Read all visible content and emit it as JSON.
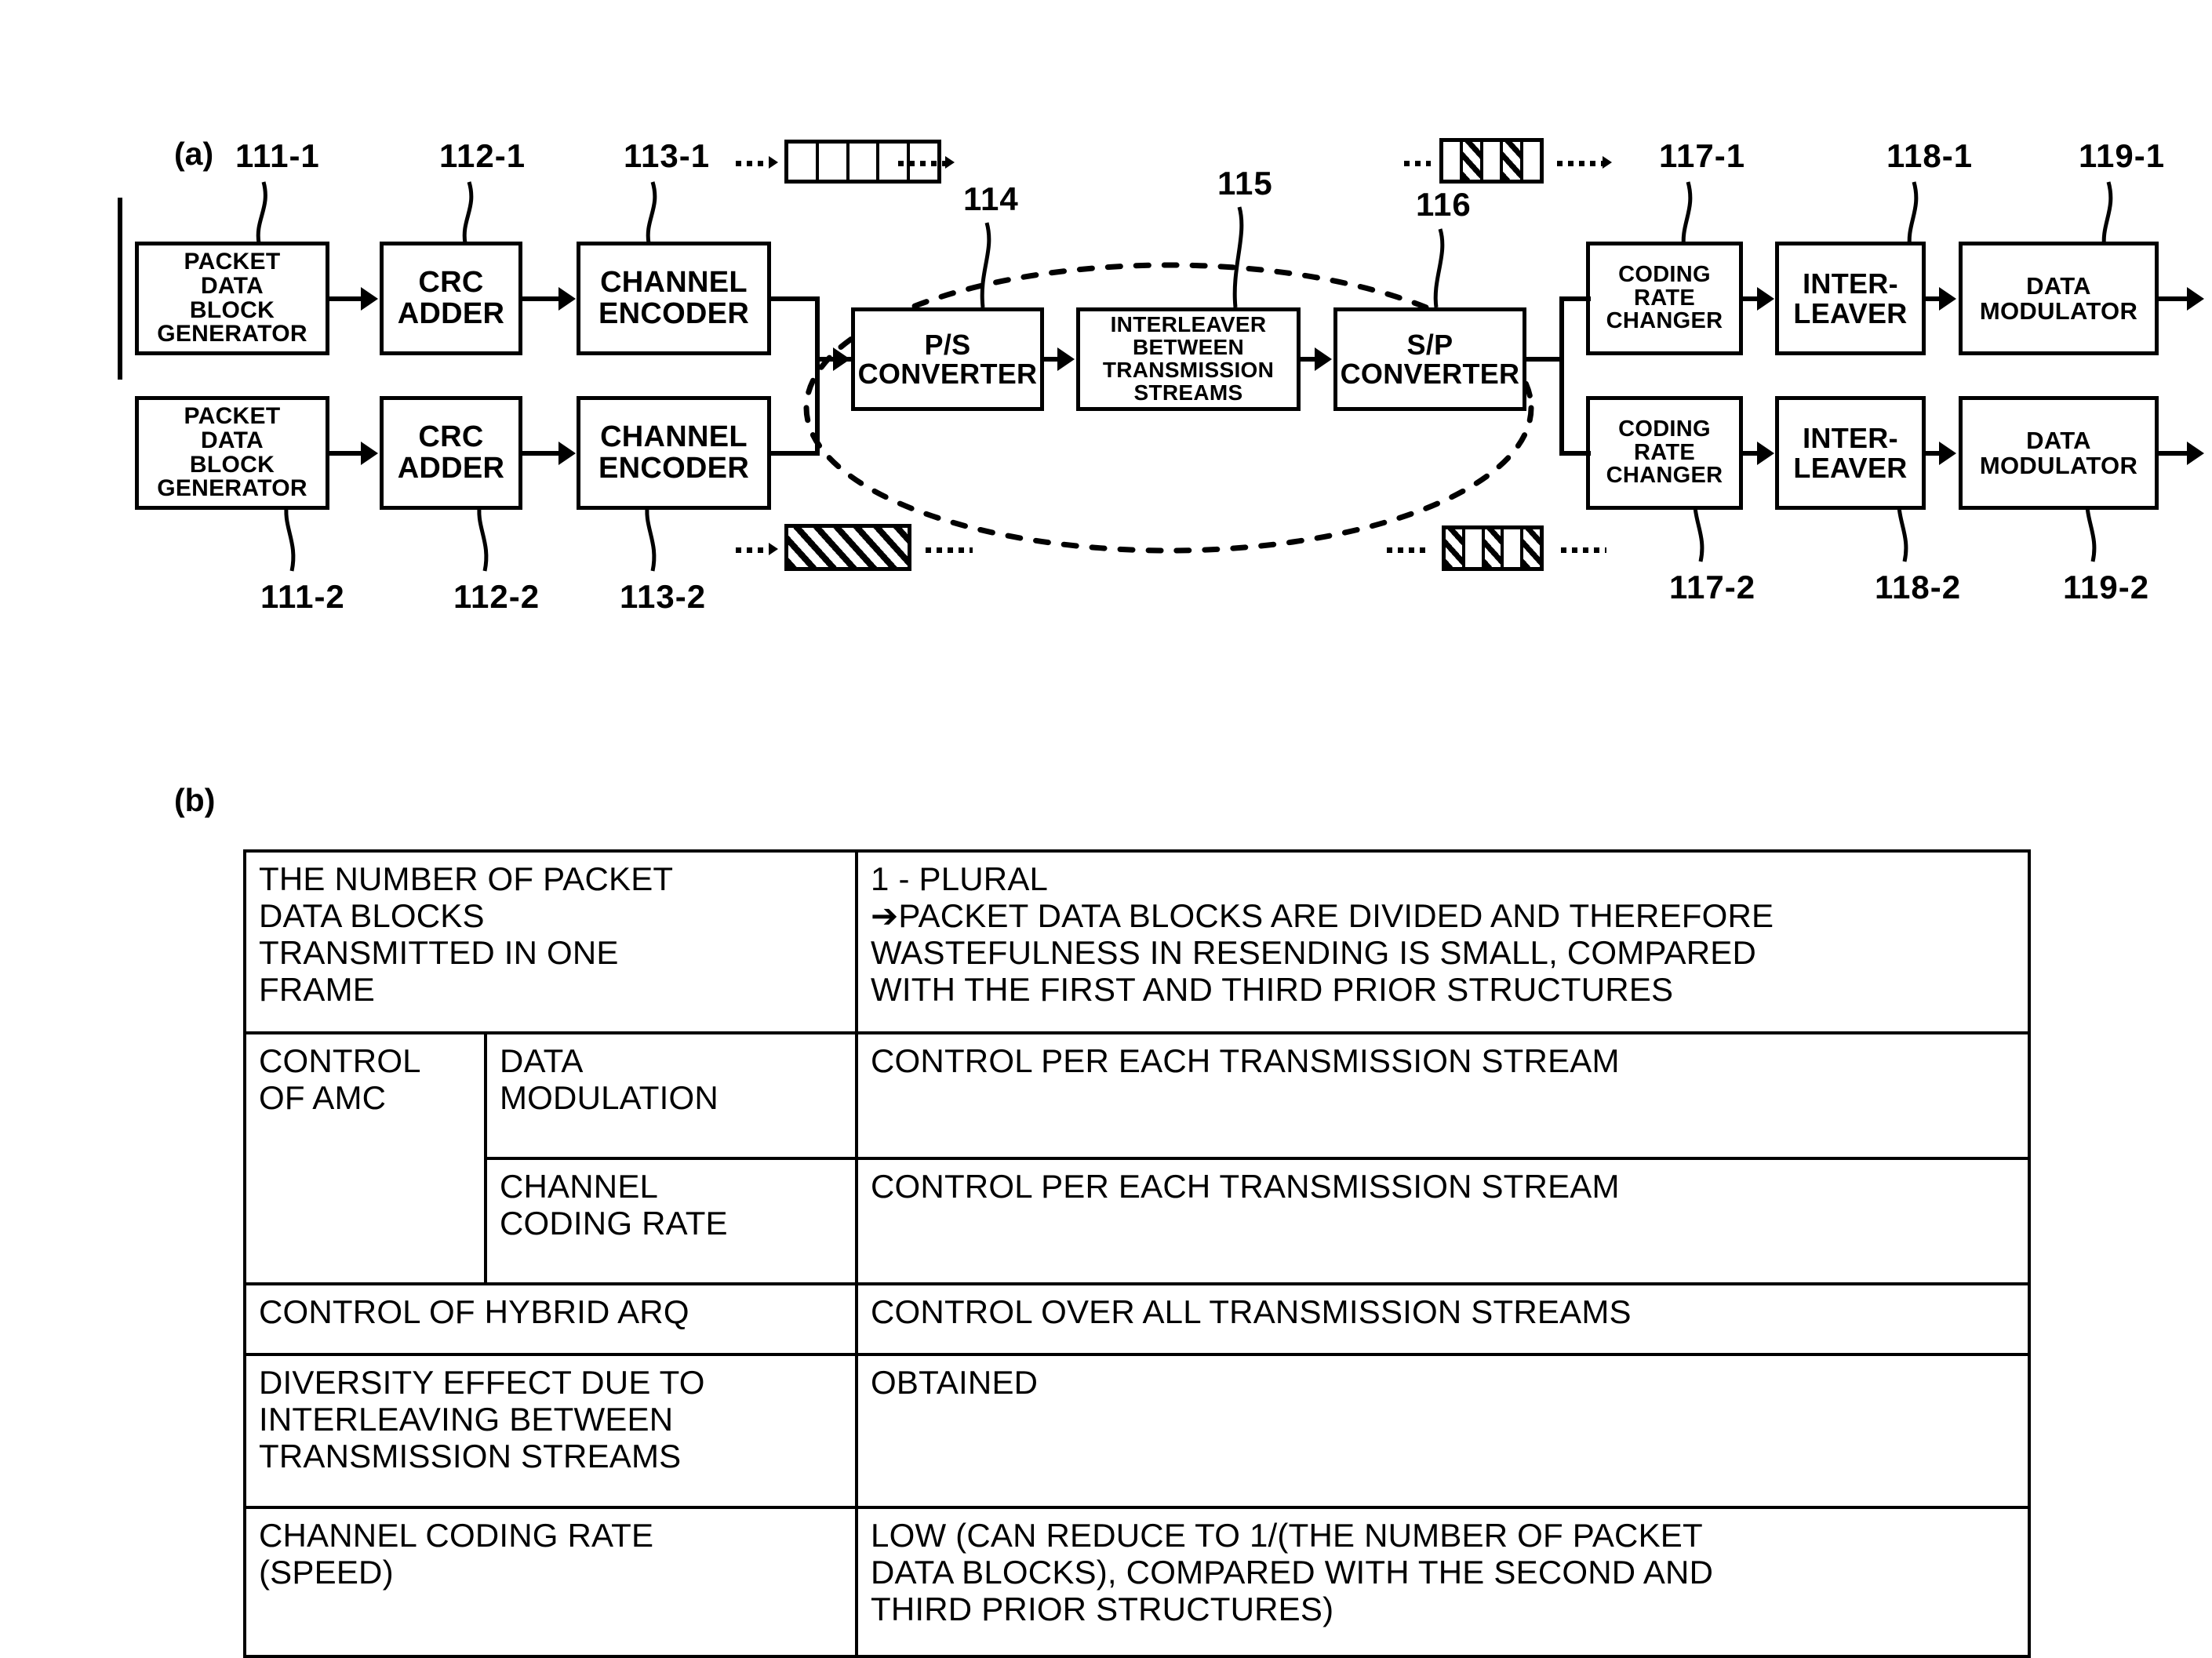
{
  "figure_a": {
    "label": "(a)",
    "blocks": [
      {
        "id": "pdbg1",
        "text": "PACKET\nDATA\nBLOCK\nGENERATOR",
        "ref": "111-1"
      },
      {
        "id": "crc1",
        "text": "CRC\nADDER",
        "ref": "112-1"
      },
      {
        "id": "chenc1",
        "text": "CHANNEL\nENCODER",
        "ref": "113-1"
      },
      {
        "id": "pdbg2",
        "text": "PACKET\nDATA\nBLOCK\nGENERATOR",
        "ref": "111-2"
      },
      {
        "id": "crc2",
        "text": "CRC\nADDER",
        "ref": "112-2"
      },
      {
        "id": "chenc2",
        "text": "CHANNEL\nENCODER",
        "ref": "113-2"
      },
      {
        "id": "ps",
        "text": "P/S\nCONVERTER",
        "ref": "114"
      },
      {
        "id": "intl",
        "text": "INTERLEAVER\nBETWEEN\nTRANSMISSION\nSTREAMS",
        "ref": "115"
      },
      {
        "id": "sp",
        "text": "S/P\nCONVERTER",
        "ref": "116"
      },
      {
        "id": "crc_rate1",
        "text": "CODING\nRATE\nCHANGER",
        "ref": "117-1"
      },
      {
        "id": "inter1",
        "text": "INTER-\nLEAVER",
        "ref": "118-1"
      },
      {
        "id": "dmod1",
        "text": "DATA\nMODULATOR",
        "ref": "119-1"
      },
      {
        "id": "crc_rate2",
        "text": "CODING\nRATE\nCHANGER",
        "ref": "117-2"
      },
      {
        "id": "inter2",
        "text": "INTER-\nLEAVER",
        "ref": "118-2"
      },
      {
        "id": "dmod2",
        "text": "DATA\nMODULATOR",
        "ref": "119-2"
      }
    ],
    "block_text": {
      "pdbg1_l1": "PACKET",
      "pdbg1_l2": "DATA",
      "pdbg1_l3": "BLOCK",
      "pdbg1_l4": "GENERATOR",
      "crc1_l1": "CRC",
      "crc1_l2": "ADDER",
      "chenc1_l1": "CHANNEL",
      "chenc1_l2": "ENCODER",
      "pdbg2_l1": "PACKET",
      "pdbg2_l2": "DATA",
      "pdbg2_l3": "BLOCK",
      "pdbg2_l4": "GENERATOR",
      "crc2_l1": "CRC",
      "crc2_l2": "ADDER",
      "chenc2_l1": "CHANNEL",
      "chenc2_l2": "ENCODER",
      "ps_l1": "P/S",
      "ps_l2": "CONVERTER",
      "intl_l1": "INTERLEAVER",
      "intl_l2": "BETWEEN",
      "intl_l3": "TRANSMISSION",
      "intl_l4": "STREAMS",
      "sp_l1": "S/P",
      "sp_l2": "CONVERTER",
      "crate1_l1": "CODING",
      "crate1_l2": "RATE",
      "crate1_l3": "CHANGER",
      "inter1_l1": "INTER-",
      "inter1_l2": "LEAVER",
      "dmod1_l1": "DATA",
      "dmod1_l2": "MODULATOR",
      "crate2_l1": "CODING",
      "crate2_l2": "RATE",
      "crate2_l3": "CHANGER",
      "inter2_l1": "INTER-",
      "inter2_l2": "LEAVER",
      "dmod2_l1": "DATA",
      "dmod2_l2": "MODULATOR"
    },
    "refs": {
      "r111_1": "111-1",
      "r112_1": "112-1",
      "r113_1": "113-1",
      "r111_2": "111-2",
      "r112_2": "112-2",
      "r113_2": "113-2",
      "r114": "114",
      "r115": "115",
      "r116": "116",
      "r117_1": "117-1",
      "r118_1": "118-1",
      "r119_1": "119-1",
      "r117_2": "117-2",
      "r118_2": "118-2",
      "r119_2": "119-2"
    },
    "frame_glyphs": [
      {
        "id": "g113_1",
        "cells": [
          "w",
          "w",
          "w",
          "w",
          "w"
        ]
      },
      {
        "id": "g113_2",
        "cells": [
          "h"
        ]
      },
      {
        "id": "g116",
        "cells": [
          "w",
          "h",
          "w",
          "h",
          "w"
        ]
      },
      {
        "id": "g117_2",
        "cells": [
          "h",
          "w",
          "h",
          "w",
          "h"
        ]
      }
    ]
  },
  "figure_b": {
    "label": "(b)",
    "rows": [
      {
        "label": "THE NUMBER OF PACKET DATA BLOCKS TRANSMITTED IN ONE FRAME",
        "value": "1 - PLURAL\n➔PACKET DATA BLOCKS ARE DIVIDED AND THEREFORE WASTEFULNESS IN RESENDING IS SMALL, COMPARED WITH THE FIRST AND THIRD PRIOR STRUCTURES"
      },
      {
        "label": "CONTROL OF AMC",
        "sublabel": "DATA MODULATION",
        "value": "CONTROL PER EACH TRANSMISSION STREAM"
      },
      {
        "sublabel": "CHANNEL CODING RATE",
        "value": "CONTROL PER EACH TRANSMISSION STREAM"
      },
      {
        "label": "CONTROL OF HYBRID ARQ",
        "value": "CONTROL OVER ALL TRANSMISSION STREAMS"
      },
      {
        "label": "DIVERSITY EFFECT DUE TO INTERLEAVING BETWEEN TRANSMISSION STREAMS",
        "value": "OBTAINED"
      },
      {
        "label": "CHANNEL CODING RATE (SPEED)",
        "value": "LOW (CAN REDUCE TO 1/(THE NUMBER OF PACKET DATA BLOCKS), COMPARED WITH THE SECOND AND THIRD PRIOR STRUCTURES)"
      }
    ],
    "cells": {
      "r1_label_l1": "THE NUMBER OF PACKET",
      "r1_label_l2": "DATA BLOCKS",
      "r1_label_l3": "TRANSMITTED IN ONE",
      "r1_label_l4": "FRAME",
      "r1_val_l1": "1 - PLURAL",
      "r1_val_l2": "➔PACKET DATA BLOCKS ARE DIVIDED AND THEREFORE",
      "r1_val_l3": "WASTEFULNESS IN RESENDING IS SMALL, COMPARED",
      "r1_val_l4": "WITH THE FIRST AND THIRD PRIOR STRUCTURES",
      "r2_label_l1": "CONTROL",
      "r2_label_l2": "OF AMC",
      "r2_sub_l1": "DATA",
      "r2_sub_l2": "MODULATION",
      "r2_val": "CONTROL PER EACH TRANSMISSION STREAM",
      "r3_sub_l1": "CHANNEL",
      "r3_sub_l2": "CODING RATE",
      "r3_val": "CONTROL PER EACH TRANSMISSION STREAM",
      "r4_label": "CONTROL OF HYBRID ARQ",
      "r4_val": "CONTROL OVER ALL TRANSMISSION STREAMS",
      "r5_label_l1": "DIVERSITY EFFECT DUE TO",
      "r5_label_l2": "INTERLEAVING BETWEEN",
      "r5_label_l3": "TRANSMISSION STREAMS",
      "r5_val": "OBTAINED",
      "r6_label_l1": "CHANNEL CODING RATE",
      "r6_label_l2": "(SPEED)",
      "r6_val_l1": "LOW (CAN REDUCE TO 1/(THE NUMBER OF PACKET",
      "r6_val_l2": "DATA BLOCKS), COMPARED WITH THE SECOND AND",
      "r6_val_l3": "THIRD PRIOR STRUCTURES)"
    }
  },
  "colors": {
    "ink": "#000000",
    "paper": "#ffffff"
  }
}
